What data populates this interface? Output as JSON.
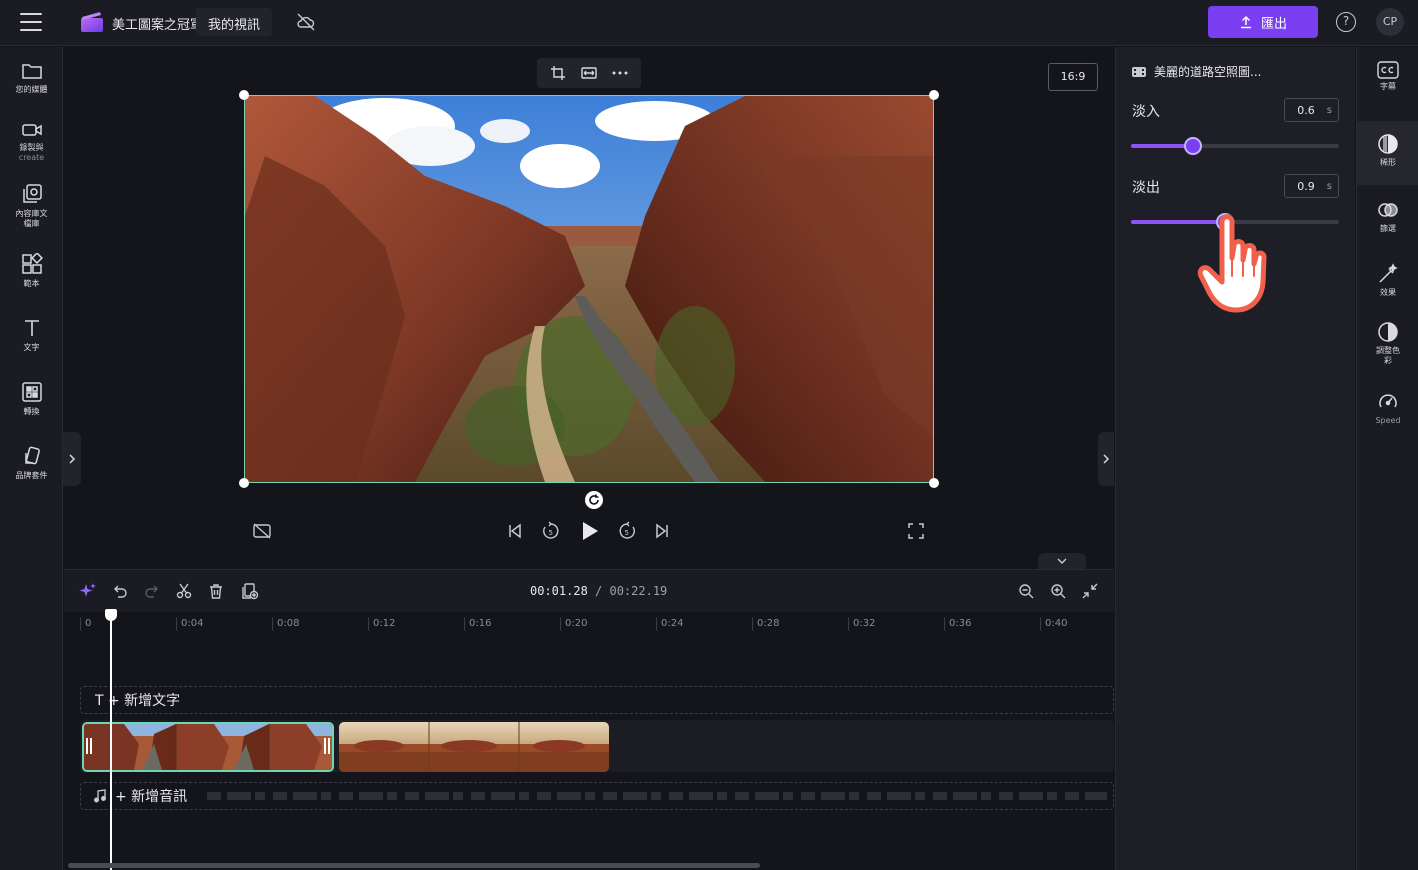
{
  "topbar": {
    "app_title": "美工圖案之冠軍",
    "project_name": "我的視訊",
    "export_label": "匯出",
    "help_label": "?",
    "avatar_initials": "CP",
    "accent_color": "#7b3ff2"
  },
  "leftbar": {
    "items": [
      {
        "label": "您的媒體",
        "icon": "folder-icon"
      },
      {
        "label": "錄製與",
        "sub": "create",
        "icon": "video-camera-icon"
      },
      {
        "label": "內容庫文",
        "sub2": "檔庫",
        "icon": "content-library-icon"
      },
      {
        "label": "範本",
        "icon": "templates-icon"
      },
      {
        "label": "文字",
        "icon": "text-icon"
      },
      {
        "label": "轉換",
        "icon": "transitions-icon"
      },
      {
        "label": "品牌套件",
        "icon": "brand-kit-icon"
      }
    ]
  },
  "canvas": {
    "aspect_ratio": "16:9"
  },
  "timeline": {
    "current_time": "00:01.28",
    "total_time": "/ 00:22.19",
    "ticks": [
      "0",
      "0:04",
      "0:08",
      "0:12",
      "0:16",
      "0:20",
      "0:24",
      "0:28",
      "0:32",
      "0:36",
      "0:40"
    ],
    "add_text_label": "T + 新增文字",
    "add_audio_label": "+ 新增音訊"
  },
  "properties": {
    "title": "美麗的道路空照圖...",
    "fade_in_label": "淡入",
    "fade_in_value": "0.6",
    "fade_in_fraction": 0.3,
    "fade_out_label": "淡出",
    "fade_out_value": "0.9",
    "fade_out_fraction": 0.45,
    "unit": "s"
  },
  "rail": {
    "items": [
      {
        "label": "字幕",
        "icon": "captions-icon"
      },
      {
        "label": "稀形",
        "icon": "fade-icon"
      },
      {
        "label": "篩選",
        "icon": "filters-icon"
      },
      {
        "label": "效果",
        "icon": "effects-wand-icon"
      },
      {
        "label": "調整色",
        "sub": "彩",
        "icon": "adjust-colors-icon"
      },
      {
        "label": "Speed",
        "icon": "speed-icon"
      }
    ]
  }
}
